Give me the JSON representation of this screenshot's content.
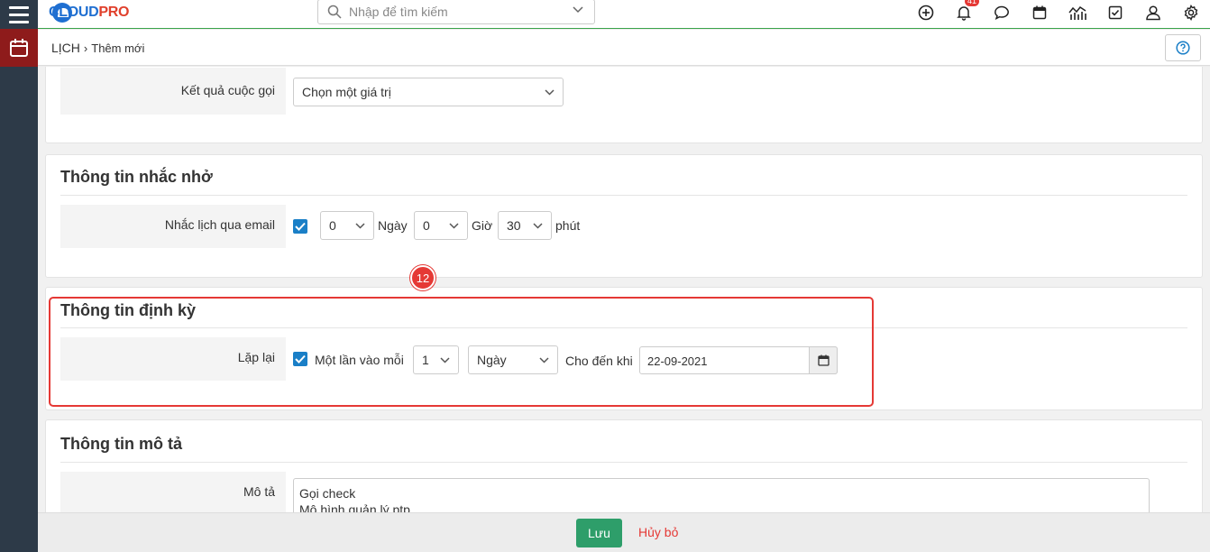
{
  "app": {
    "logo_text_1": "CLOUD",
    "logo_text_2": "PRO",
    "search_placeholder": "Nhập để tìm kiếm",
    "notification_count": "41"
  },
  "breadcrumb": {
    "module": "LỊCH",
    "separator": "›",
    "page": "Thêm mới"
  },
  "call_result": {
    "label": "Kết quả cuộc gọi",
    "value": "Chọn một giá trị"
  },
  "reminder": {
    "title": "Thông tin nhắc nhở",
    "label": "Nhắc lịch qua email",
    "checked": true,
    "days": "0",
    "days_unit": "Ngày",
    "hours": "0",
    "hours_unit": "Giờ",
    "minutes": "30",
    "minutes_unit": "phút"
  },
  "recurrence": {
    "annotation_number": "12",
    "title": "Thông tin định kỳ",
    "label": "Lặp lại",
    "checked": true,
    "once_every": "Một lần vào mỗi",
    "interval": "1",
    "unit": "Ngày",
    "until_label": "Cho đến khi",
    "until_date": "22-09-2021"
  },
  "description": {
    "title": "Thông tin mô tả",
    "label": "Mô tả",
    "line_1": "Gọi check",
    "line_2": "Mô hình quản lý ptp"
  },
  "footer": {
    "save_label": "Lưu",
    "cancel_label": "Hủy bỏ"
  },
  "colors": {
    "accent_green": "#2e9e6a",
    "checkbox_blue": "#1a7fc7",
    "highlight_red": "#e53935",
    "rail_dark": "#2d3a48",
    "rail_active": "#8e1b1b"
  }
}
